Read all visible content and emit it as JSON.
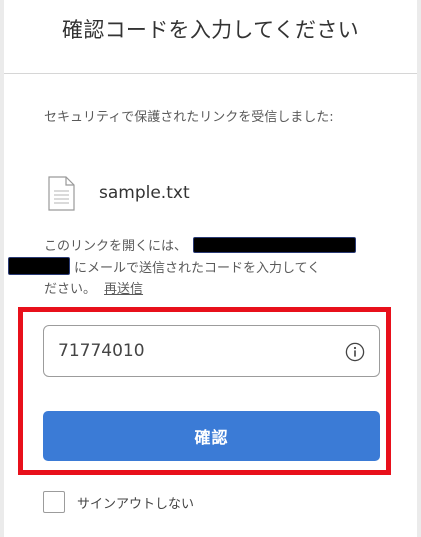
{
  "header": {
    "title": "確認コードを入力してください"
  },
  "intro": {
    "text": "セキュリティで保護されたリンクを受信しました:"
  },
  "file": {
    "icon": "document-icon",
    "name": "sample.txt"
  },
  "instructions": {
    "line1": "このリンクを開くには、",
    "line2": "にメールで送信されたコードを入力してく",
    "line3": "ださい。",
    "resend_label": "再送信"
  },
  "code_field": {
    "value": "71774010",
    "info_icon": "info-icon"
  },
  "confirm_button": {
    "label": "確認"
  },
  "stay_signed_in": {
    "label": "サインアウトしない",
    "checked": false
  },
  "colors": {
    "accent": "#3b7bd6",
    "highlight": "#e8101b",
    "redaction": "#000000"
  }
}
